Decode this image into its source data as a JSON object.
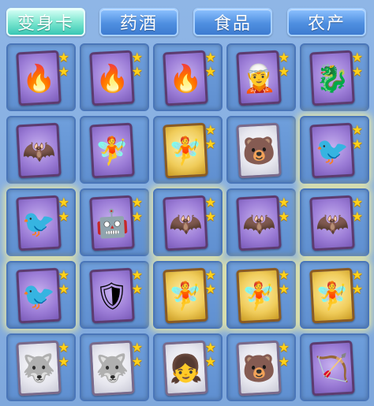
{
  "tabs": [
    {
      "label": "变身卡",
      "active": true
    },
    {
      "label": "药酒",
      "active": false
    },
    {
      "label": "食品",
      "active": false
    },
    {
      "label": "农产",
      "active": false
    }
  ],
  "grid": {
    "rows": [
      [
        {
          "card": "purple",
          "figure": "🔥",
          "icon_name": "fire-monster-card-icon",
          "stars": 2,
          "glow": false
        },
        {
          "card": "purple",
          "figure": "🔥",
          "icon_name": "fire-monster-card-icon",
          "stars": 2,
          "glow": false
        },
        {
          "card": "purple",
          "figure": "🔥",
          "icon_name": "fire-monster-card-icon",
          "stars": 2,
          "glow": false
        },
        {
          "card": "purple",
          "figure": "🧝",
          "icon_name": "armored-warrior-card-icon",
          "stars": 2,
          "glow": false
        },
        {
          "card": "purple",
          "figure": "🐉",
          "icon_name": "dragon-card-icon",
          "stars": 2,
          "glow": false
        }
      ],
      [
        {
          "card": "purple",
          "figure": "🦇",
          "icon_name": "bat-creature-card-icon",
          "stars": 0,
          "glow": false
        },
        {
          "card": "purple",
          "figure": "🧚",
          "icon_name": "fairy-card-icon",
          "stars": 0,
          "glow": false
        },
        {
          "card": "gold",
          "figure": "🧚",
          "icon_name": "fairy-girl-card-icon",
          "stars": 2,
          "glow": false
        },
        {
          "card": "white",
          "figure": "🐻",
          "icon_name": "bear-card-icon",
          "stars": 0,
          "glow": false
        },
        {
          "card": "purple",
          "figure": "🐦",
          "icon_name": "bird-card-icon",
          "stars": 2,
          "glow": true
        }
      ],
      [
        {
          "card": "purple",
          "figure": "🐦",
          "icon_name": "bird-card-icon",
          "stars": 2,
          "glow": true
        },
        {
          "card": "purple",
          "figure": "🤖",
          "icon_name": "mech-card-icon",
          "stars": 2,
          "glow": false
        },
        {
          "card": "purple",
          "figure": "🦇",
          "icon_name": "bat-creature-card-icon",
          "stars": 2,
          "glow": true
        },
        {
          "card": "purple",
          "figure": "🦇",
          "icon_name": "bat-creature-card-icon",
          "stars": 2,
          "glow": false
        },
        {
          "card": "purple",
          "figure": "🦇",
          "icon_name": "bat-creature-card-icon",
          "stars": 2,
          "glow": true
        }
      ],
      [
        {
          "card": "purple",
          "figure": "🐦",
          "icon_name": "phoenix-card-icon",
          "stars": 2,
          "glow": true
        },
        {
          "card": "purple",
          "figure": "🛡",
          "icon_name": "knight-card-icon",
          "stars": 2,
          "glow": false
        },
        {
          "card": "gold",
          "figure": "🧚",
          "icon_name": "fairy-girl-card-icon",
          "stars": 2,
          "glow": true
        },
        {
          "card": "gold",
          "figure": "🧚",
          "icon_name": "fairy-girl-card-icon",
          "stars": 2,
          "glow": true
        },
        {
          "card": "gold",
          "figure": "🧚",
          "icon_name": "fairy-girl-card-icon",
          "stars": 2,
          "glow": true
        }
      ],
      [
        {
          "card": "white",
          "figure": "🐺",
          "icon_name": "ice-beast-card-icon",
          "stars": 2,
          "glow": false
        },
        {
          "card": "white",
          "figure": "🐺",
          "icon_name": "ice-beast-card-icon",
          "stars": 2,
          "glow": false
        },
        {
          "card": "white",
          "figure": "👧",
          "icon_name": "pink-girl-card-icon",
          "stars": 2,
          "glow": false
        },
        {
          "card": "white",
          "figure": "🐻",
          "icon_name": "bear-card-icon",
          "stars": 2,
          "glow": false
        },
        {
          "card": "purple",
          "figure": "🏹",
          "icon_name": "archer-card-icon",
          "stars": 0,
          "glow": false
        }
      ]
    ]
  }
}
